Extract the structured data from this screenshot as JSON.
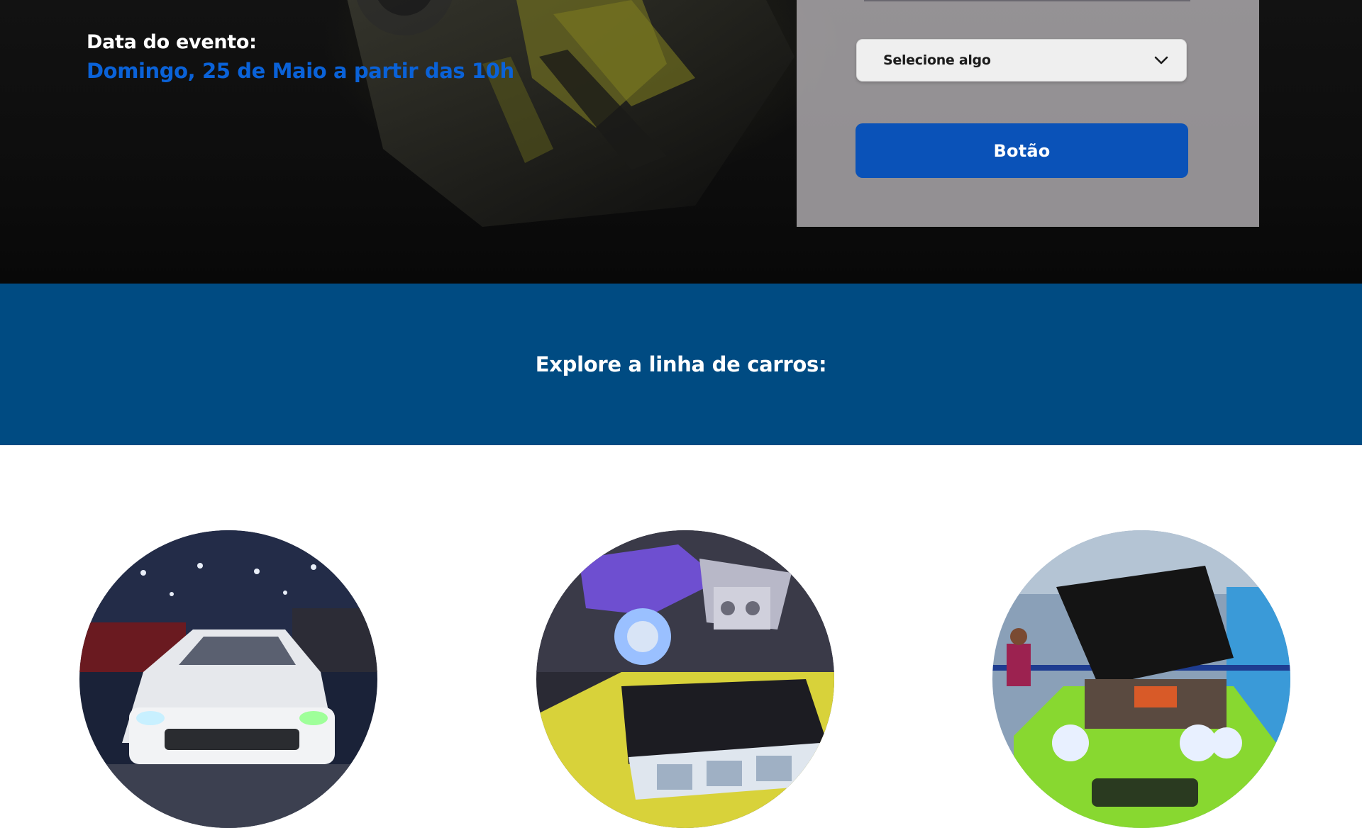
{
  "hero": {
    "event_label": "Data do evento:",
    "event_date": "Domingo, 25 de Maio a partir das 10h"
  },
  "form": {
    "select_value": "Selecione algo",
    "button_label": "Botão"
  },
  "band": {
    "title": "Explore a linha de carros:"
  },
  "colors": {
    "accent_blue": "#0a62d8",
    "button_blue": "#0a52b8",
    "band_blue": "#004b82",
    "panel_gray": "#c8c4c8"
  },
  "icons": {
    "select_chevron": "chevron-down-icon"
  }
}
